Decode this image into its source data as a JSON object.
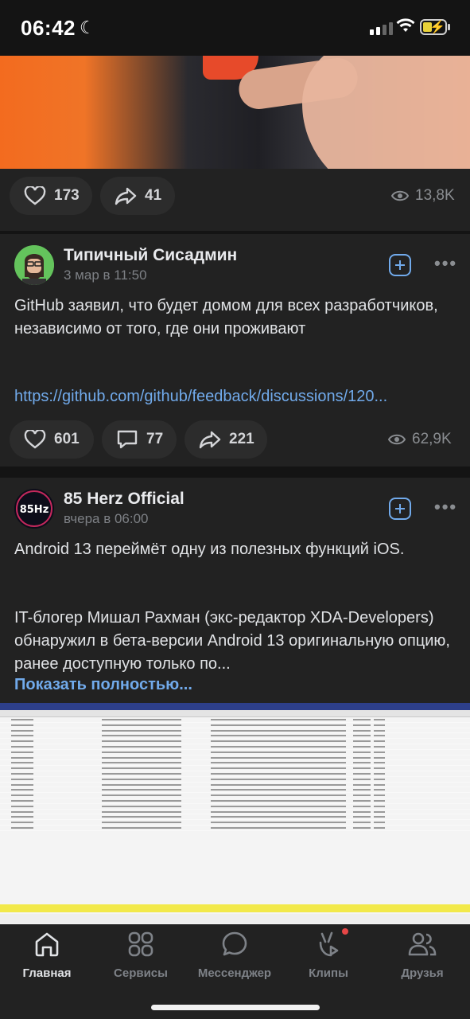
{
  "status_bar": {
    "time": "06:42"
  },
  "post_top": {
    "likes": "173",
    "reposts": "41",
    "views": "13,8K"
  },
  "post1": {
    "author": "Типичный Сисадмин",
    "date": "3 мар в 11:50",
    "text": "GitHub заявил, что будет домом для всех разработчиков, независимо от того, где они проживают",
    "link": "https://github.com/github/feedback/discussions/120...",
    "likes": "601",
    "comments": "77",
    "reposts": "221",
    "views": "62,9K"
  },
  "post2": {
    "author": "85 Herz Official",
    "avatar_text": "85Hz",
    "date": "вчера в 06:00",
    "text_line1": "Android 13 переймёт одну из полезных функций iOS.",
    "text_body": "IT-блогер Мишал Рахман (экс-редактор XDA-Developers) обнаружил в бета-версии Android 13 оригинальную опцию, ранее доступную только по...",
    "show_more": "Показать полностью..."
  },
  "tabs": [
    {
      "label": "Главная",
      "icon": "home-icon",
      "active": true
    },
    {
      "label": "Сервисы",
      "icon": "services-icon",
      "active": false
    },
    {
      "label": "Мессенджер",
      "icon": "messenger-icon",
      "active": false
    },
    {
      "label": "Клипы",
      "icon": "clips-icon",
      "active": false
    },
    {
      "label": "Друзья",
      "icon": "friends-icon",
      "active": false
    }
  ],
  "colors": {
    "accent": "#71aaeb",
    "background": "#141414",
    "card": "#222222",
    "badge": "#e64646"
  }
}
